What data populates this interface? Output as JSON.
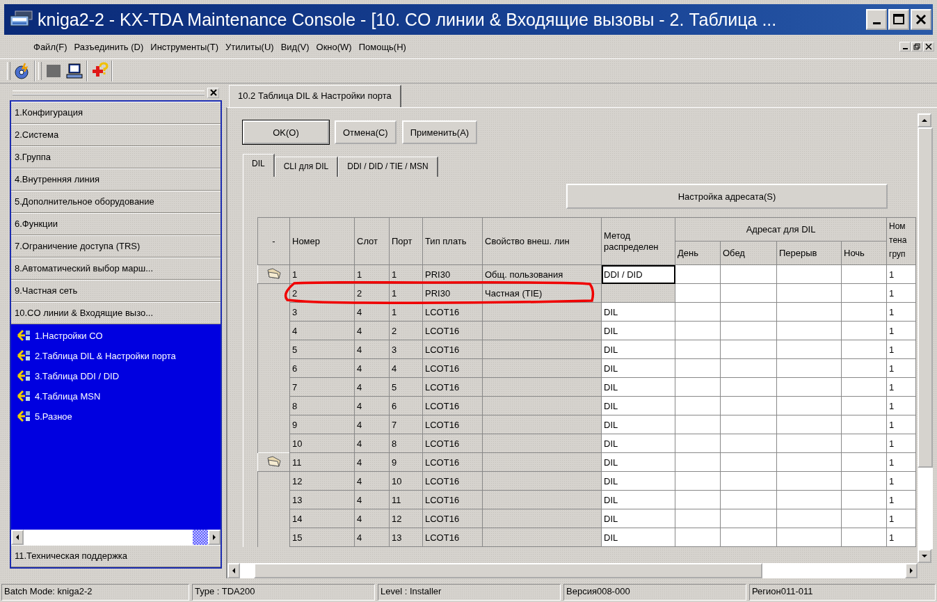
{
  "window": {
    "title": "kniga2-2 - KX-TDA Maintenance Console - [10. CO линии & Входящие вызовы - 2. Таблица ..."
  },
  "menu": [
    "Файл(F)",
    "Разъединить (D)",
    "Инструменты(T)",
    "Утилиты(U)",
    "Вид(V)",
    "Окно(W)",
    "Помощь(H)"
  ],
  "sidebar": {
    "items": [
      {
        "label": "1.Конфигурация"
      },
      {
        "label": "2.Система"
      },
      {
        "label": "3.Группа"
      },
      {
        "label": "4.Внутренняя линия"
      },
      {
        "label": "5.Дополнительное оборудование"
      },
      {
        "label": "6.Функции"
      },
      {
        "label": "7.Ограничение доступа (TRS)"
      },
      {
        "label": "8.Автоматический выбор марш..."
      },
      {
        "label": "9.Частная сеть"
      },
      {
        "label": "10.CO линии & Входящие вызо...",
        "expanded": true,
        "children": [
          "1.Настройки CO",
          "2.Таблица DIL & Настройки порта",
          "3.Таблица DDI / DID",
          "4.Таблица MSN",
          "5.Разное"
        ]
      },
      {
        "label": "11.Техническая поддержка",
        "expanded": false
      }
    ]
  },
  "page_tabs": [
    {
      "label": "10.2 Таблица DIL & Настройки порта",
      "selected": true
    }
  ],
  "buttons": [
    "OK(O)",
    "Отмена(C)",
    "Применить(A)"
  ],
  "tabs": [
    {
      "label": "DIL",
      "selected": true
    },
    {
      "label": "CLI для DIL",
      "selected": false
    },
    {
      "label": "DDI / DID / TIE / MSN",
      "selected": false
    }
  ],
  "destination_button": "Настройка адресата(S)",
  "table": {
    "columns": [
      "-",
      "Номер",
      "Слот",
      "Порт",
      "Тип плать",
      "Свойство внеш. лин",
      "Метод распределен"
    ],
    "group_header": "Адресат для DIL",
    "group_columns": [
      "День",
      "Обед",
      "Перерыв",
      "Ночь"
    ],
    "last_column": "Ном тена груп",
    "rows": [
      {
        "marker": true,
        "circled": false,
        "number": "1",
        "slot": "1",
        "port": "1",
        "card": "PRI30",
        "property": "Общ. пользования",
        "method": "DDI / DID",
        "focused": true,
        "tenant": "1"
      },
      {
        "marker": false,
        "circled": true,
        "number": "2",
        "slot": "2",
        "port": "1",
        "card": "PRI30",
        "property": "Частная (TIE)",
        "focused": false,
        "tenant": "1"
      },
      {
        "marker": false,
        "circled": false,
        "number": "3",
        "slot": "4",
        "port": "1",
        "card": "LCOT16",
        "method": "DIL",
        "focused": false,
        "tenant": "1"
      },
      {
        "marker": false,
        "circled": false,
        "number": "4",
        "slot": "4",
        "port": "2",
        "card": "LCOT16",
        "method": "DIL",
        "focused": false,
        "tenant": "1"
      },
      {
        "marker": false,
        "circled": false,
        "number": "5",
        "slot": "4",
        "port": "3",
        "card": "LCOT16",
        "method": "DIL",
        "focused": false,
        "tenant": "1"
      },
      {
        "marker": false,
        "circled": false,
        "number": "6",
        "slot": "4",
        "port": "4",
        "card": "LCOT16",
        "method": "DIL",
        "focused": false,
        "tenant": "1"
      },
      {
        "marker": false,
        "circled": false,
        "number": "7",
        "slot": "4",
        "port": "5",
        "card": "LCOT16",
        "method": "DIL",
        "focused": false,
        "tenant": "1"
      },
      {
        "marker": false,
        "circled": false,
        "number": "8",
        "slot": "4",
        "port": "6",
        "card": "LCOT16",
        "method": "DIL",
        "focused": false,
        "tenant": "1"
      },
      {
        "marker": false,
        "circled": false,
        "number": "9",
        "slot": "4",
        "port": "7",
        "card": "LCOT16",
        "method": "DIL",
        "focused": false,
        "tenant": "1"
      },
      {
        "marker": false,
        "circled": false,
        "number": "10",
        "slot": "4",
        "port": "8",
        "card": "LCOT16",
        "method": "DIL",
        "focused": false,
        "tenant": "1"
      },
      {
        "marker": true,
        "circled": false,
        "number": "11",
        "slot": "4",
        "port": "9",
        "card": "LCOT16",
        "method": "DIL",
        "focused": false,
        "tenant": "1"
      },
      {
        "marker": false,
        "circled": false,
        "number": "12",
        "slot": "4",
        "port": "10",
        "card": "LCOT16",
        "method": "DIL",
        "focused": false,
        "tenant": "1"
      },
      {
        "marker": false,
        "circled": false,
        "number": "13",
        "slot": "4",
        "port": "11",
        "card": "LCOT16",
        "method": "DIL",
        "focused": false,
        "tenant": "1"
      },
      {
        "marker": false,
        "circled": false,
        "number": "14",
        "slot": "4",
        "port": "12",
        "card": "LCOT16",
        "method": "DIL",
        "focused": false,
        "tenant": "1"
      },
      {
        "marker": false,
        "circled": false,
        "number": "15",
        "slot": "4",
        "port": "13",
        "card": "LCOT16",
        "method": "DIL",
        "focused": false,
        "tenant": "1"
      }
    ]
  },
  "status_bar": [
    "Batch Mode: kniga2-2",
    "Type : TDA200",
    "Level : Installer",
    "Версия008-000",
    "Регион011-011"
  ]
}
